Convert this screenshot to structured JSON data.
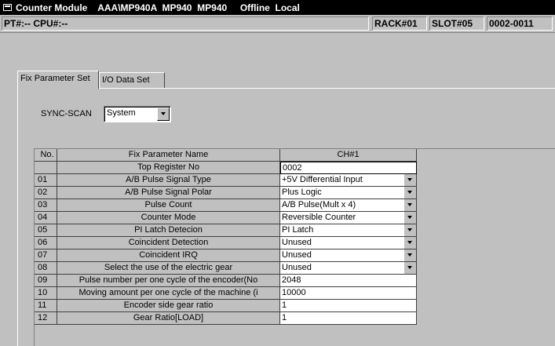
{
  "window": {
    "title": "Counter Module    AAA\\MP940A  MP940  MP940     Offline  Local"
  },
  "info": {
    "pt_cpu": "PT#:-- CPU#:--",
    "rack": "RACK#01",
    "slot": "SLOT#05",
    "range": "0002-0011"
  },
  "tabs": [
    {
      "label": "Fix Parameter Set"
    },
    {
      "label": "I/O Data Set"
    }
  ],
  "sync_scan": {
    "label": "SYNC-SCAN",
    "value": "System"
  },
  "table": {
    "headers": {
      "no": "No.",
      "name": "Fix Parameter Name",
      "ch": "CH#1"
    },
    "top_register": {
      "no": "",
      "name": "Top Register No",
      "value": "0002"
    },
    "rows": [
      {
        "no": "01",
        "name": "A/B Pulse Signal Type",
        "value": "+5V Differential Input",
        "dropdown": true
      },
      {
        "no": "02",
        "name": "A/B Pulse Signal Polar",
        "value": "Plus Logic",
        "dropdown": true
      },
      {
        "no": "03",
        "name": "Pulse Count",
        "value": "A/B Pulse(Mult x 4)",
        "dropdown": true
      },
      {
        "no": "04",
        "name": "Counter Mode",
        "value": "Reversible Counter",
        "dropdown": true
      },
      {
        "no": "05",
        "name": "PI Latch Detecion",
        "value": "PI Latch",
        "dropdown": true
      },
      {
        "no": "06",
        "name": "Coincident Detection",
        "value": "Unused",
        "dropdown": true
      },
      {
        "no": "07",
        "name": "Coincident IRQ",
        "value": "Unused",
        "dropdown": true
      },
      {
        "no": "08",
        "name": "Select the use of the electric gear",
        "value": "Unused",
        "dropdown": true
      },
      {
        "no": "09",
        "name": "Pulse number per one cycle of the encoder(No",
        "value": "2048",
        "dropdown": false
      },
      {
        "no": "10",
        "name": "Moving amount per one cycle of the machine (i",
        "value": "10000",
        "dropdown": false
      },
      {
        "no": "11",
        "name": "Encoder side gear ratio",
        "value": "1",
        "dropdown": false
      },
      {
        "no": "12",
        "name": "Gear Ratio[LOAD]",
        "value": "1",
        "dropdown": false
      }
    ]
  }
}
